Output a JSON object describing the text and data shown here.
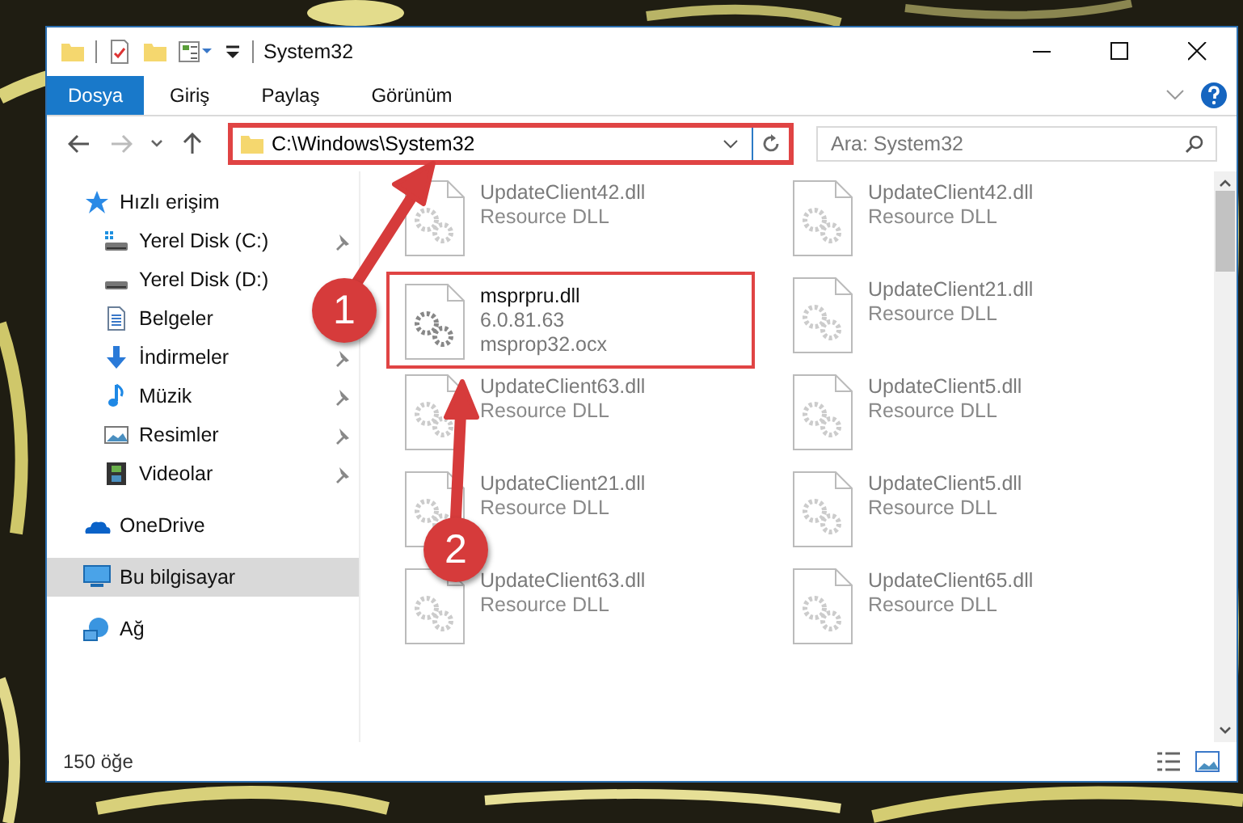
{
  "window": {
    "title": "System32"
  },
  "ribbon_tabs": [
    {
      "label": "Dosya",
      "selected": true
    },
    {
      "label": "Giriş",
      "selected": false
    },
    {
      "label": "Paylaş",
      "selected": false
    },
    {
      "label": "Görünüm",
      "selected": false
    }
  ],
  "address_bar": {
    "path": "C:\\Windows\\System32",
    "highlighted": true
  },
  "search": {
    "placeholder": "Ara: System32"
  },
  "sidebar": {
    "items": [
      {
        "label": "Hızlı erişim",
        "kind": "star",
        "selected": false,
        "children": [
          {
            "label": "Yerel Disk (C:)",
            "kind": "windrive",
            "pinned": true,
            "selected": false
          },
          {
            "label": "Yerel Disk (D:)",
            "kind": "drive",
            "selected": false
          },
          {
            "label": "Belgeler",
            "kind": "documents",
            "selected": false
          },
          {
            "label": "İndirmeler",
            "kind": "download",
            "pinned": true,
            "selected": false
          },
          {
            "label": "Müzik",
            "kind": "music",
            "pinned": true,
            "selected": false
          },
          {
            "label": "Resimler",
            "kind": "pictures",
            "pinned": true,
            "selected": false
          },
          {
            "label": "Videolar",
            "kind": "videos",
            "pinned": true,
            "selected": false
          }
        ]
      },
      {
        "label": "OneDrive",
        "kind": "cloud",
        "selected": false
      },
      {
        "label": "Bu bilgisayar",
        "kind": "computer",
        "selected": true
      },
      {
        "label": "Ağ",
        "kind": "network",
        "selected": false
      }
    ]
  },
  "files": [
    {
      "name": "UpdateClient42.dll",
      "lines": [
        "Resource DLL"
      ],
      "blurred": true,
      "highlighted": false
    },
    {
      "name": "UpdateClient42.dll",
      "lines": [
        "Resource DLL"
      ],
      "blurred": true,
      "highlighted": false
    },
    {
      "name": "msprpru.dll",
      "lines": [
        "6.0.81.63",
        "msprop32.ocx"
      ],
      "blurred": false,
      "highlighted": true
    },
    {
      "name": "UpdateClient21.dll",
      "lines": [
        "Resource DLL"
      ],
      "blurred": true,
      "highlighted": false
    },
    {
      "name": "UpdateClient63.dll",
      "lines": [
        "Resource DLL"
      ],
      "blurred": true,
      "highlighted": false
    },
    {
      "name": "UpdateClient5.dll",
      "lines": [
        "Resource DLL"
      ],
      "blurred": true,
      "highlighted": false
    },
    {
      "name": "UpdateClient21.dll",
      "lines": [
        "Resource DLL"
      ],
      "blurred": true,
      "highlighted": false
    },
    {
      "name": "UpdateClient5.dll",
      "lines": [
        "Resource DLL"
      ],
      "blurred": true,
      "highlighted": false
    },
    {
      "name": "UpdateClient63.dll",
      "lines": [
        "Resource DLL"
      ],
      "blurred": true,
      "highlighted": false
    },
    {
      "name": "UpdateClient65.dll",
      "lines": [
        "Resource DLL"
      ],
      "blurred": true,
      "highlighted": false
    }
  ],
  "status_bar": {
    "count": "150 öğe"
  },
  "annotations": [
    {
      "label": "1"
    },
    {
      "label": "2"
    }
  ]
}
